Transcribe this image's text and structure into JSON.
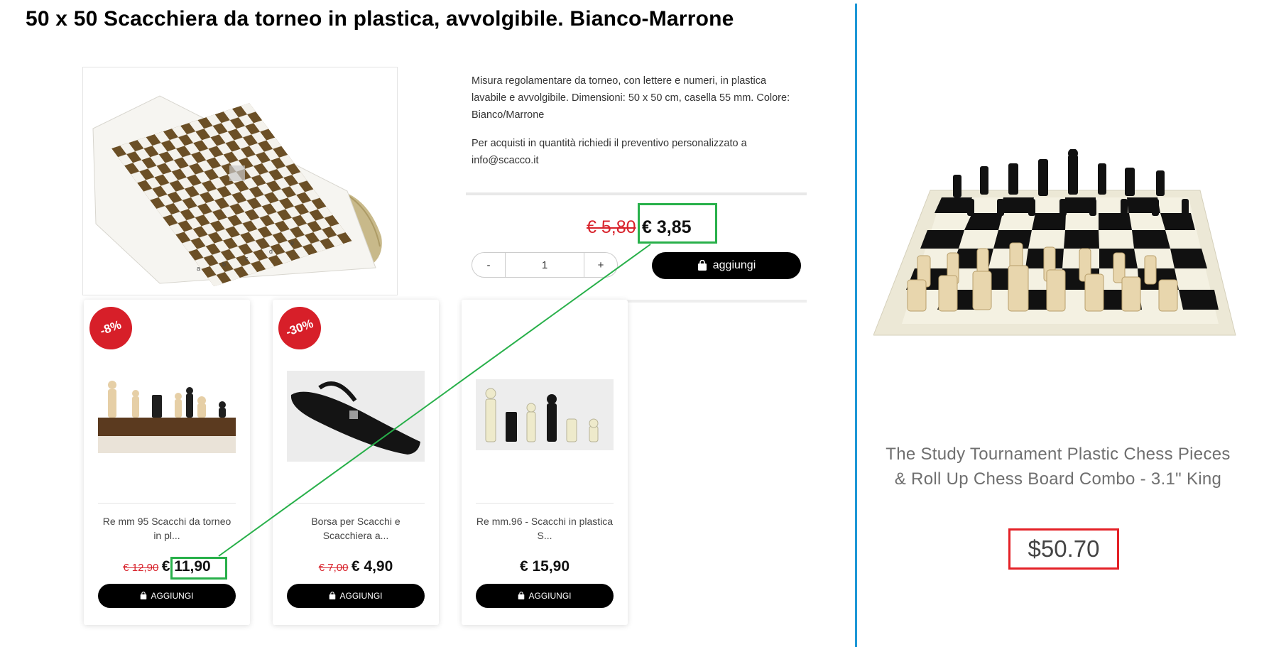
{
  "product": {
    "title": "50 x 50 Scacchiera da torneo in plastica, avvolgibile. Bianco-Marrone",
    "description_1": "Misura regolamentare da torneo, con lettere e numeri, in plastica lavabile e avvolgibile. Dimensioni: 50 x 50 cm, casella 55 mm. Colore: Bianco/Marrone",
    "description_2": "Per acquisti in quantità richiedi il preventivo personalizzato a info@scacco.it",
    "old_price": "€ 5,80",
    "new_price": "€ 3,85",
    "quantity": "1",
    "qty_minus": "-",
    "qty_plus": "+",
    "add_label": "aggiungi",
    "image_icon": "chessboard-rollup-brown-image"
  },
  "related": [
    {
      "badge": "-8%",
      "name": "Re mm 95 Scacchi da torneo in pl...",
      "old_price": "€ 12,90",
      "new_price": "€ 11,90",
      "add_label": "AGGIUNGI",
      "image_icon": "chess-pieces-wood-image"
    },
    {
      "badge": "-30%",
      "name": "Borsa per Scacchi e Scacchiera a...",
      "old_price": "€ 7,00",
      "new_price": "€ 4,90",
      "add_label": "AGGIUNGI",
      "image_icon": "chess-bag-image"
    },
    {
      "badge": "",
      "name": "Re mm.96 - Scacchi in plastica S...",
      "old_price": "",
      "new_price": "€ 15,90",
      "add_label": "AGGIUNGI",
      "image_icon": "chess-pieces-plastic-image"
    }
  ],
  "comparison": {
    "name": "The Study Tournament Plastic Chess Pieces & Roll Up Chess Board Combo - 3.1\" King",
    "price": "$50.70",
    "image_icon": "chess-set-combo-image"
  },
  "colors": {
    "highlight_green": "#28b04a",
    "highlight_red": "#e42127",
    "discount_badge": "#d71f29",
    "divider_blue": "#1e97d6",
    "board_brown": "#6b4f26"
  }
}
